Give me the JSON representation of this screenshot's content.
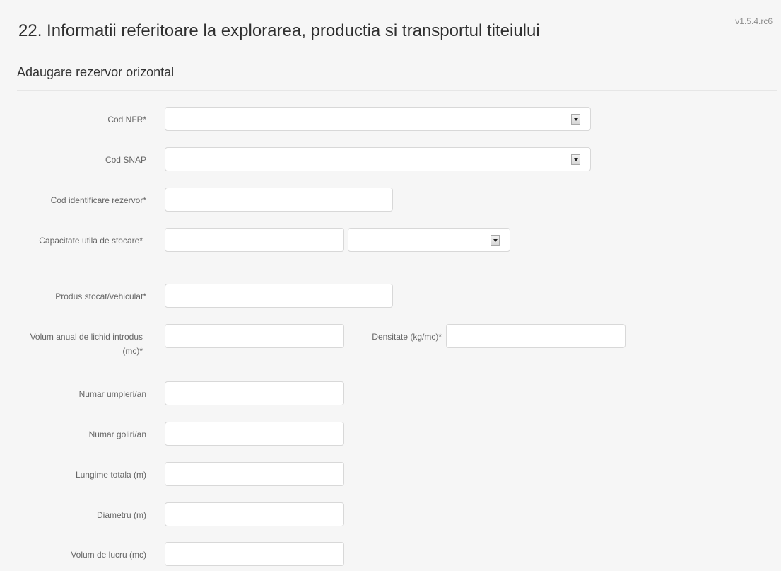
{
  "version": "v1.5.4.rc6",
  "page": {
    "title": "22. Informatii referitoare la explorarea, productia si transportul titeiului",
    "subtitle": "Adaugare rezervor orizontal"
  },
  "form": {
    "cod_nfr": {
      "label": "Cod NFR*",
      "value": ""
    },
    "cod_snap": {
      "label": "Cod SNAP",
      "value": ""
    },
    "cod_identificare": {
      "label": "Cod identificare rezervor*",
      "value": ""
    },
    "capacitate": {
      "label": "Capacitate utila de stocare*",
      "value": "",
      "unit": ""
    },
    "produs": {
      "label": "Produs stocat/vehiculat*",
      "value": ""
    },
    "volum_anual": {
      "label": "Volum anual de lichid introdus (mc)*",
      "value": ""
    },
    "densitate": {
      "label": "Densitate (kg/mc)*",
      "value": ""
    },
    "numar_umpleri": {
      "label": "Numar umpleri/an",
      "value": ""
    },
    "numar_goliri": {
      "label": "Numar goliri/an",
      "value": ""
    },
    "lungime": {
      "label": "Lungime totala (m)",
      "value": ""
    },
    "diametru": {
      "label": "Diametru (m)",
      "value": ""
    },
    "volum_lucru": {
      "label": "Volum de lucru (mc)",
      "value": ""
    }
  }
}
